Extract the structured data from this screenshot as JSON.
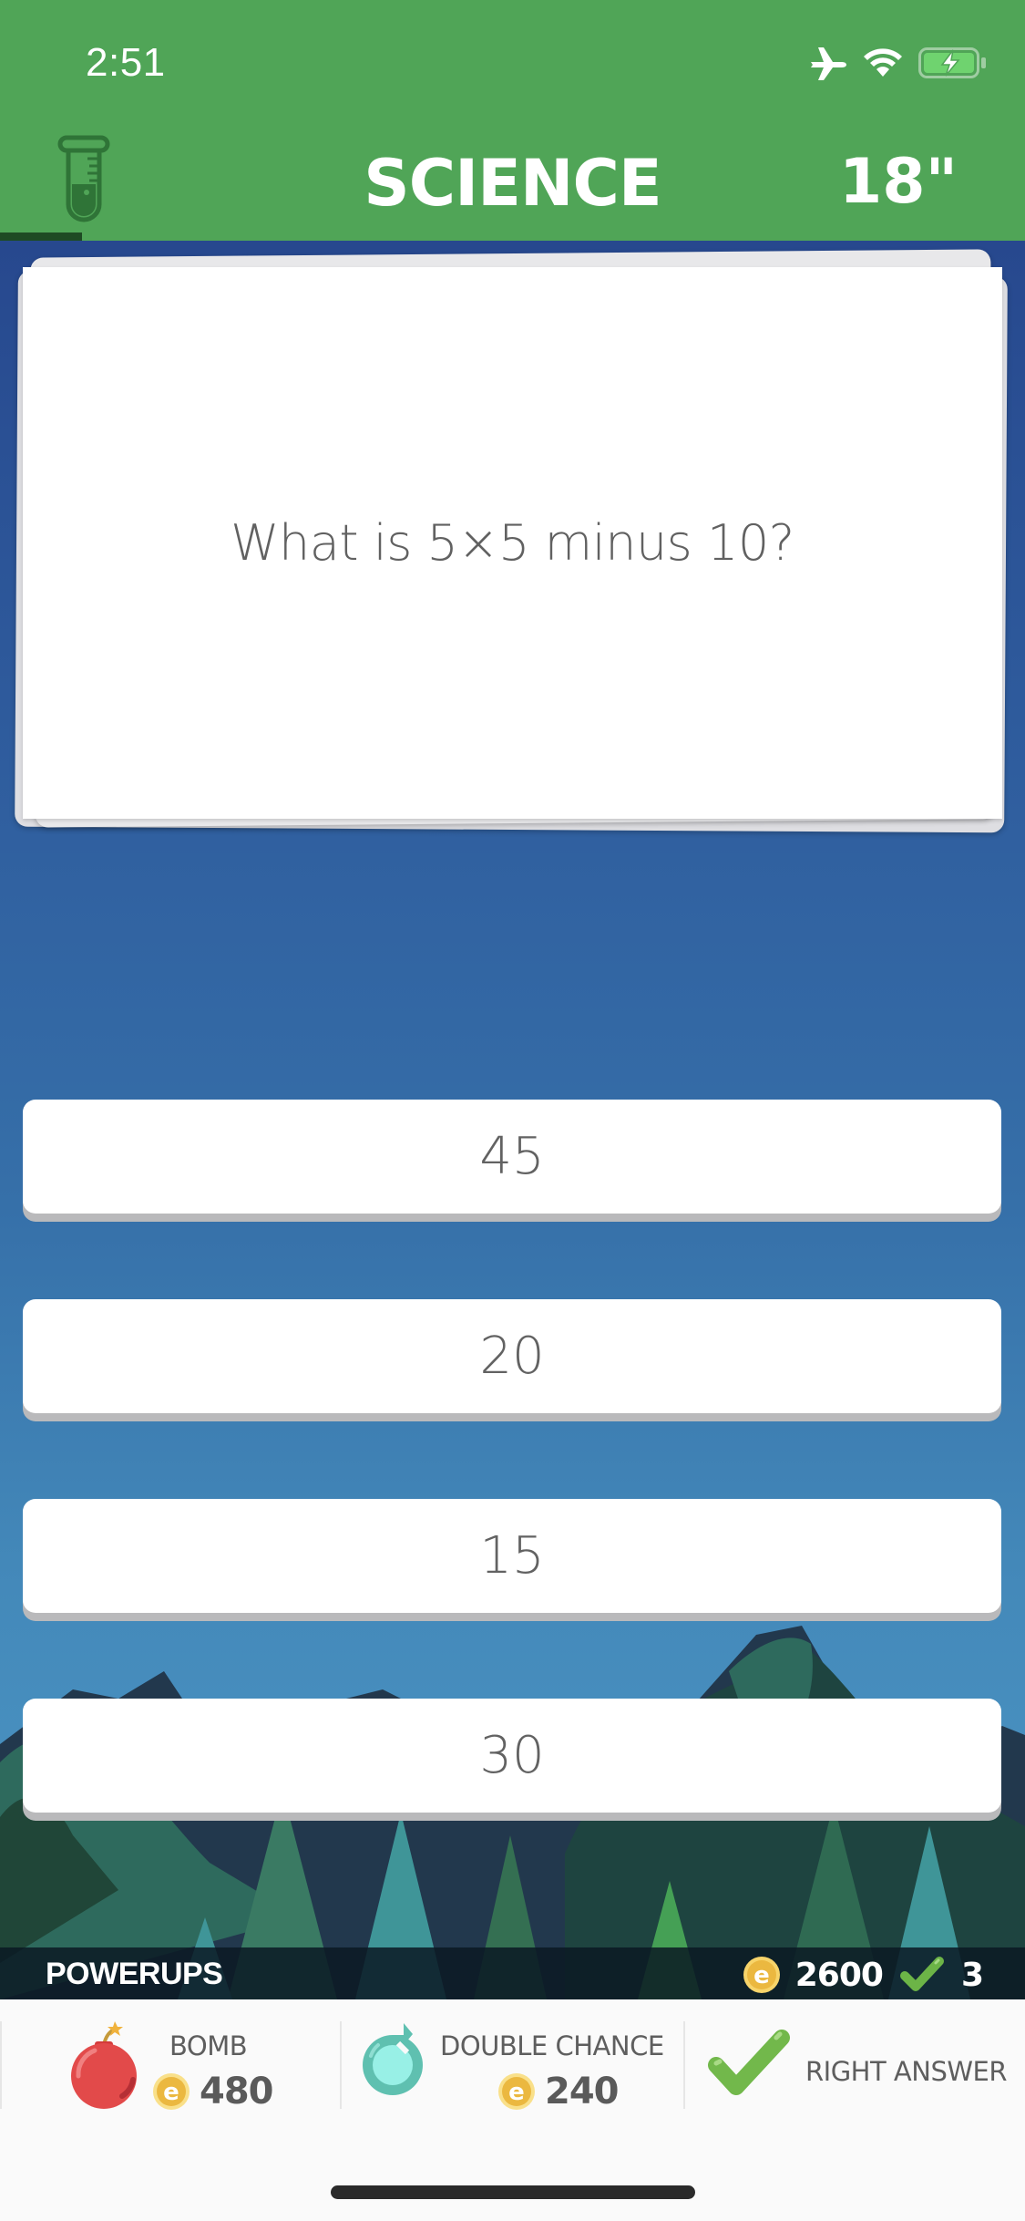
{
  "status_bar": {
    "time": "2:51",
    "icons": [
      "airplane-mode-icon",
      "wifi-icon",
      "battery-charging-icon"
    ]
  },
  "header": {
    "category_icon": "test-tube-icon",
    "category": "SCIENCE",
    "timer": "18\"",
    "progress_fraction": 0.08
  },
  "question": {
    "text": "What is 5×5 minus 10?"
  },
  "answers": [
    {
      "label": "45"
    },
    {
      "label": "20"
    },
    {
      "label": "15"
    },
    {
      "label": "30"
    }
  ],
  "powerups_bar": {
    "label": "POWERUPS",
    "coins": "2600",
    "correct_count": "3"
  },
  "powerups": [
    {
      "name": "BOMB",
      "icon": "bomb-icon",
      "price": "480"
    },
    {
      "name": "DOUBLE CHANCE",
      "icon": "double-chance-icon",
      "price": "240"
    },
    {
      "name": "RIGHT ANSWER",
      "icon": "checkmark-icon"
    }
  ],
  "colors": {
    "header_green": "#50a557",
    "progress_dark_green": "#1e4a23",
    "coin_gold": "#f2c44e",
    "check_green": "#74b84e",
    "bomb_red": "#e04848",
    "double_chance_teal": "#5dc4b4"
  }
}
